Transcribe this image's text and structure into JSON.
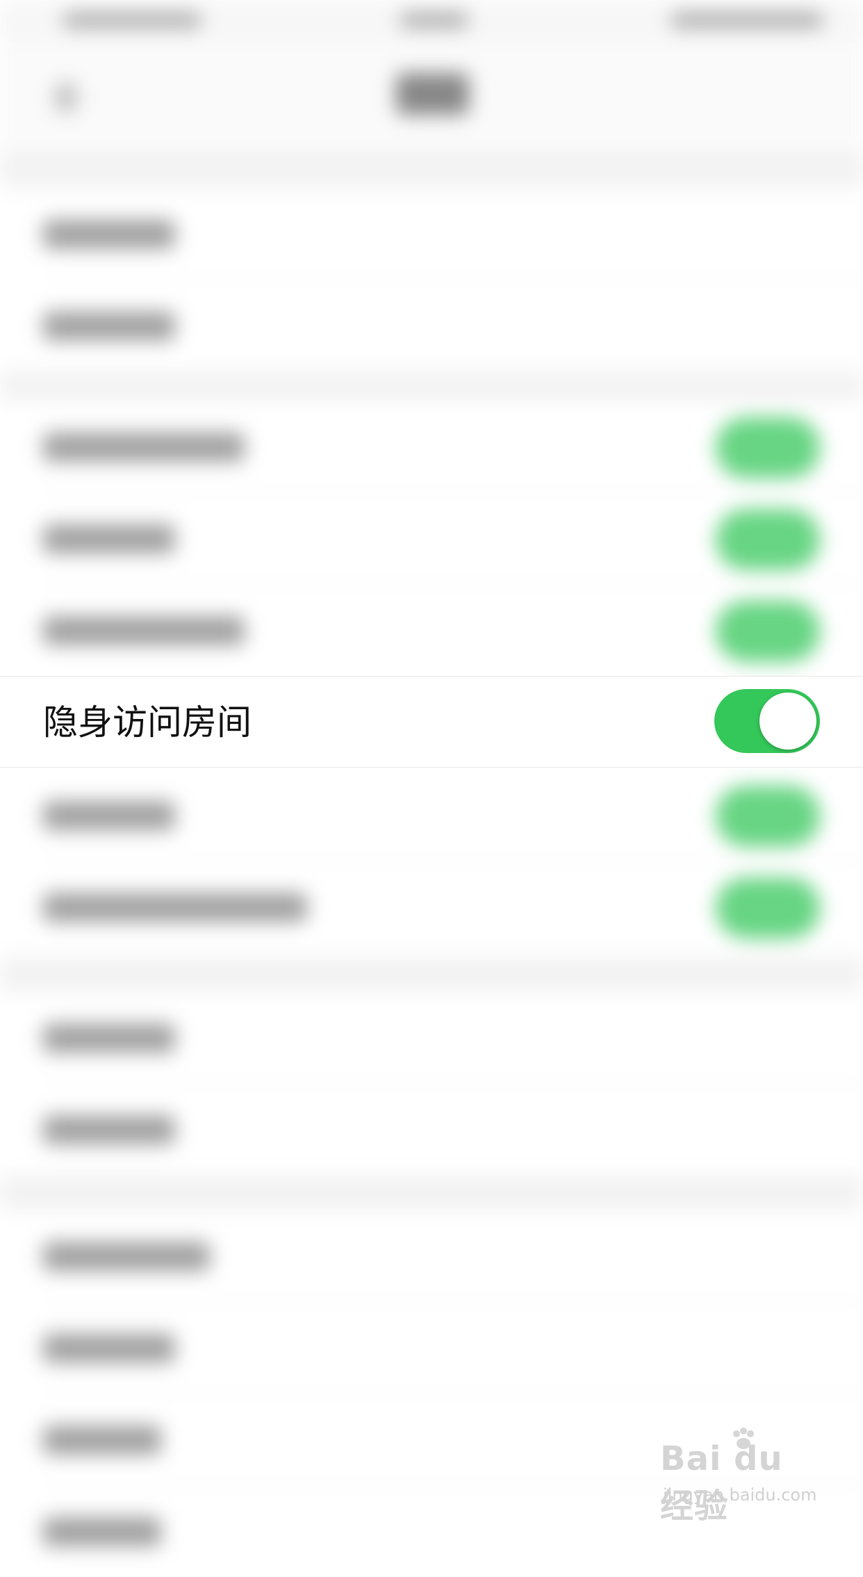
{
  "settings": {
    "focused_item": {
      "label": "隐身访问房间",
      "toggle_on": true
    }
  },
  "colors": {
    "toggle_on": "#34c759",
    "background": "#f2f2f2",
    "row_background": "#ffffff"
  },
  "watermark": {
    "logo": "Bai du 经验",
    "url": "jingyan.baidu.com"
  }
}
